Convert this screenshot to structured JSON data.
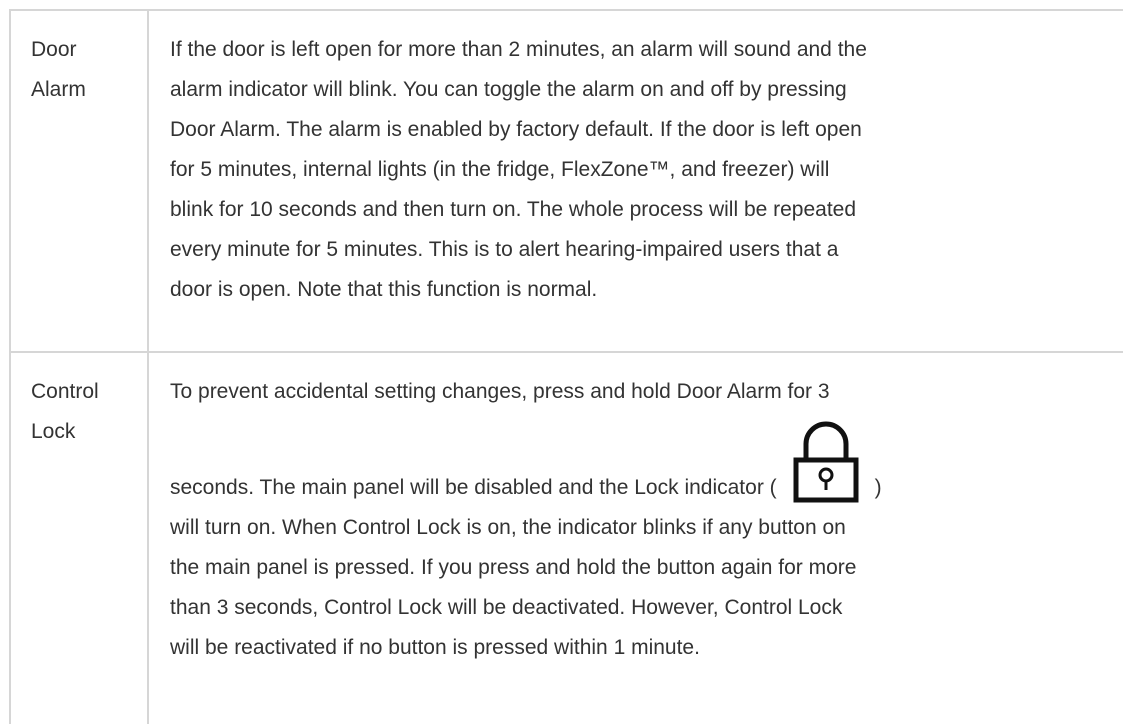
{
  "rows": [
    {
      "label_line1": "Door",
      "label_line2": "Alarm",
      "lines": [
        "If the door is left open for more than 2 minutes, an alarm will sound and the",
        "alarm indicator will blink. You can toggle the alarm on and off by pressing",
        "Door Alarm. The alarm is enabled by factory default. If the door is left open",
        "for 5 minutes, internal lights (in the fridge, FlexZone™, and freezer) will",
        "blink for 10 seconds and then turn on. The whole process will be repeated",
        "every minute for 5 minutes. This is to alert hearing-impaired users that a",
        "door is open. Note that this function is normal."
      ]
    },
    {
      "label_line1": "Control",
      "label_line2": "Lock",
      "line1": "To prevent accidental setting changes, press and hold Door Alarm for 3",
      "line2_before_icon": "seconds. The main panel will be disabled and the Lock indicator (",
      "line2_after_icon": ")",
      "icon": "lock-icon",
      "lines_rest": [
        "will turn on. When Control Lock is on, the indicator blinks if any button on",
        "the main panel is pressed. If you press and hold the button again for more",
        "than 3 seconds, Control Lock will be deactivated. However, Control Lock",
        "will be reactivated if no button is pressed within 1 minute."
      ]
    }
  ]
}
